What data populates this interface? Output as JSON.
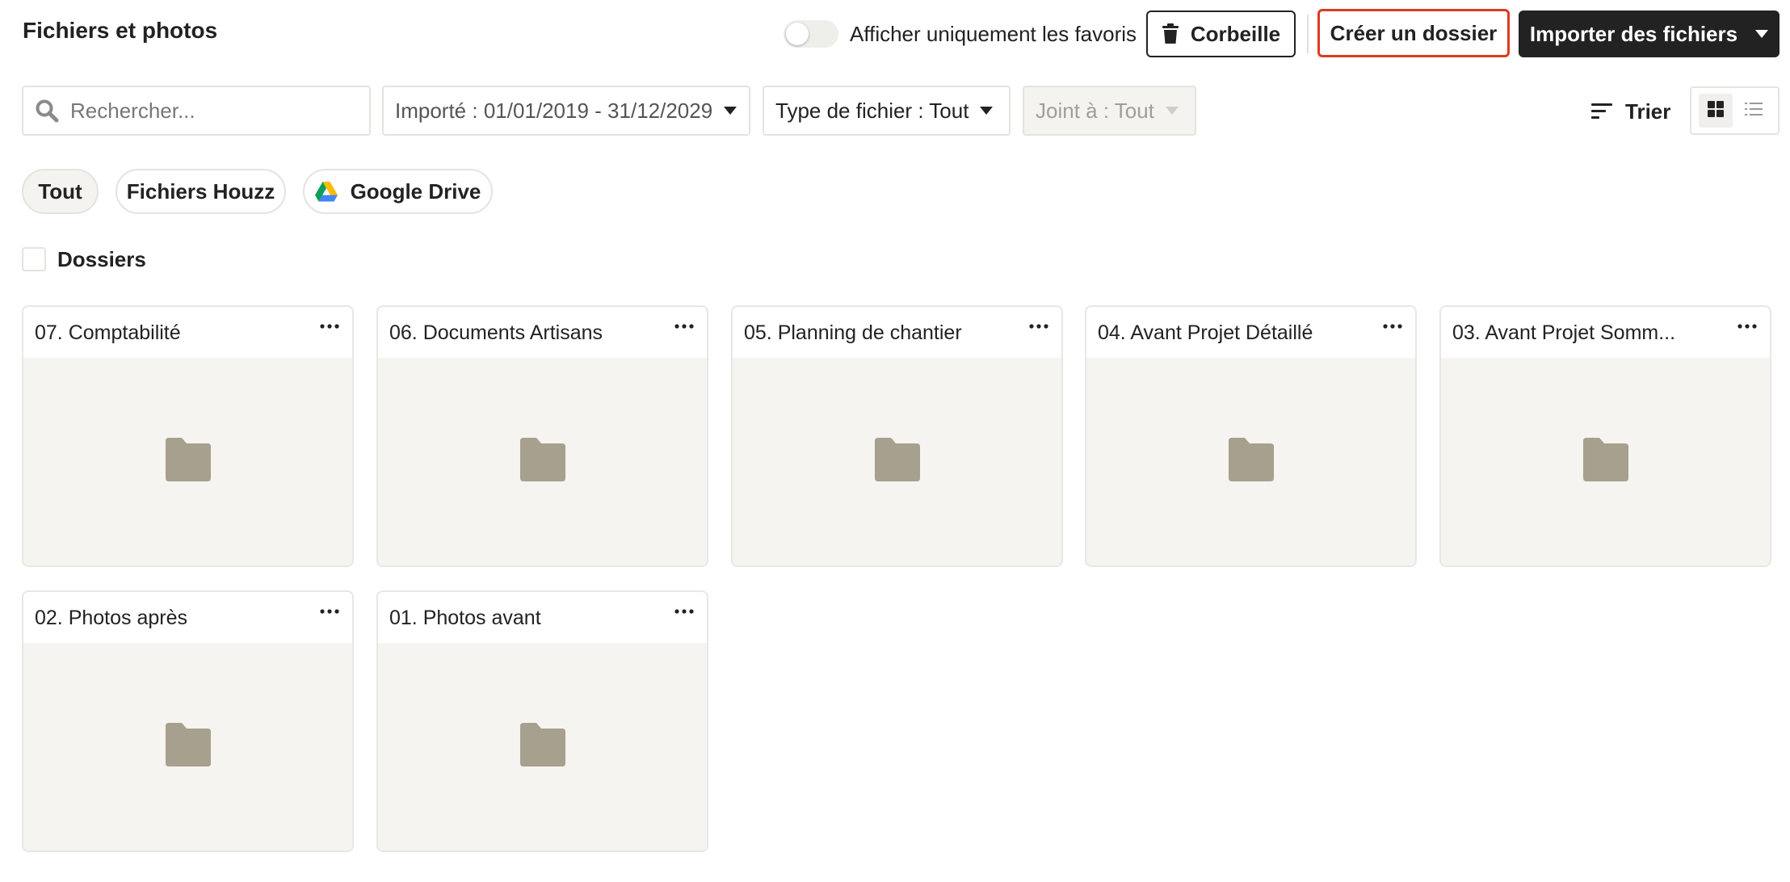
{
  "header": {
    "title": "Fichiers et photos",
    "favorites_toggle_label": "Afficher uniquement les favoris",
    "favorites_toggle_on": false,
    "trash_label": "Corbeille",
    "create_folder_label": "Créer un dossier",
    "import_label": "Importer des fichiers"
  },
  "filters": {
    "search_placeholder": "Rechercher...",
    "search_value": "",
    "imported": "Importé : 01/01/2019 - 31/12/2029",
    "file_type": "Type de fichier : Tout",
    "attached_to": "Joint à : Tout",
    "sort_label": "Trier",
    "view_mode": "grid"
  },
  "sources": {
    "all": "Tout",
    "houzz": "Fichiers Houzz",
    "gdrive": "Google Drive",
    "selected": "all"
  },
  "section": {
    "label": "Dossiers"
  },
  "folders": [
    {
      "name": "07. Comptabilité"
    },
    {
      "name": "06. Documents Artisans"
    },
    {
      "name": "05. Planning de chantier"
    },
    {
      "name": "04. Avant Projet Détaillé"
    },
    {
      "name": "03. Avant Projet Somm..."
    },
    {
      "name": "02. Photos après"
    },
    {
      "name": "01. Photos avant"
    }
  ],
  "colors": {
    "primary_dark": "#222222",
    "highlight_border": "#dd3b1f",
    "folder_icon": "#a8a08e",
    "card_body": "#f5f4f0",
    "border": "#e3e3e0"
  },
  "icons": {
    "search": "search-icon",
    "trash": "trash-icon",
    "caret": "caret-down-icon",
    "sort": "sort-icon",
    "grid": "grid-view-icon",
    "list": "list-view-icon",
    "gdrive": "google-drive-icon",
    "folder": "folder-icon",
    "more": "more-options-icon"
  }
}
